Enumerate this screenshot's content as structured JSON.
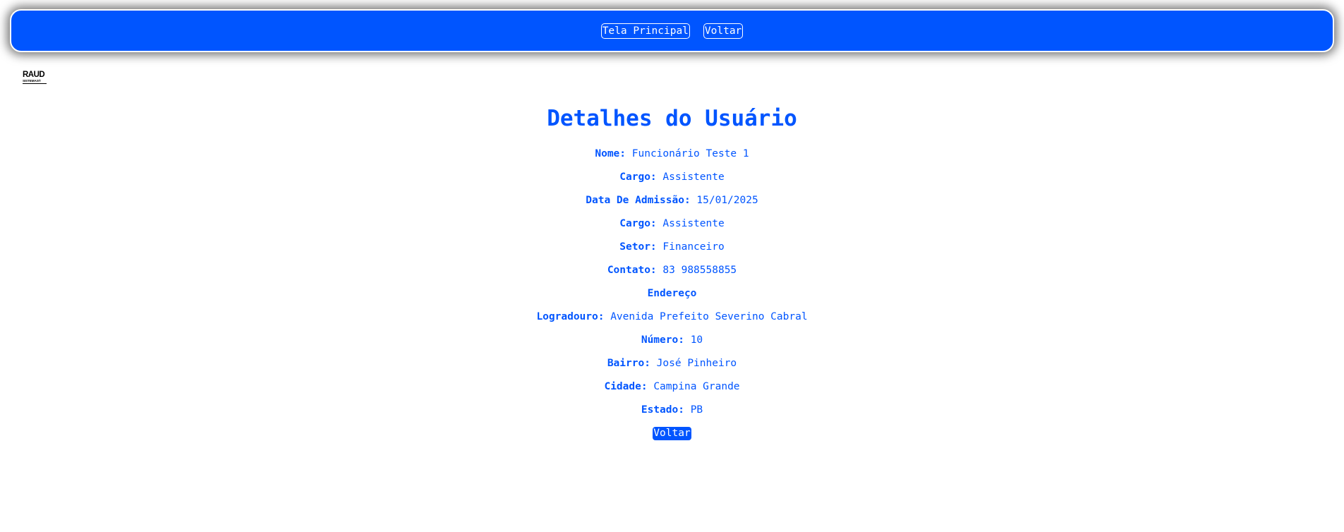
{
  "header": {
    "home_label": "Tela Principal",
    "back_label": "Voltar"
  },
  "logo": {
    "name": "RAUD",
    "tagline": "SISTEMAS®"
  },
  "page": {
    "title": "Detalhes do Usuário"
  },
  "details": {
    "nome_label": "Nome:",
    "nome": "Funcionário Teste 1",
    "cargo_label": "Cargo:",
    "cargo": "Assistente",
    "admissao_label": "Data De Admissão:",
    "admissao": "15/01/2025",
    "cargo2_label": "Cargo:",
    "cargo2": "Assistente",
    "setor_label": "Setor:",
    "setor": "Financeiro",
    "contato_label": "Contato:",
    "contato": "83 988558855"
  },
  "endereco": {
    "heading": "Endereço",
    "logradouro_label": "Logradouro:",
    "logradouro": "Avenida Prefeito Severino Cabral",
    "numero_label": "Número:",
    "numero": "10",
    "bairro_label": "Bairro:",
    "bairro": "José Pinheiro",
    "cidade_label": "Cidade:",
    "cidade": "Campina Grande",
    "estado_label": "Estado:",
    "estado": "PB"
  },
  "footer": {
    "back_label": "Voltar"
  },
  "colors": {
    "primary": "#0055ff",
    "text_on_primary": "#ffffff"
  }
}
